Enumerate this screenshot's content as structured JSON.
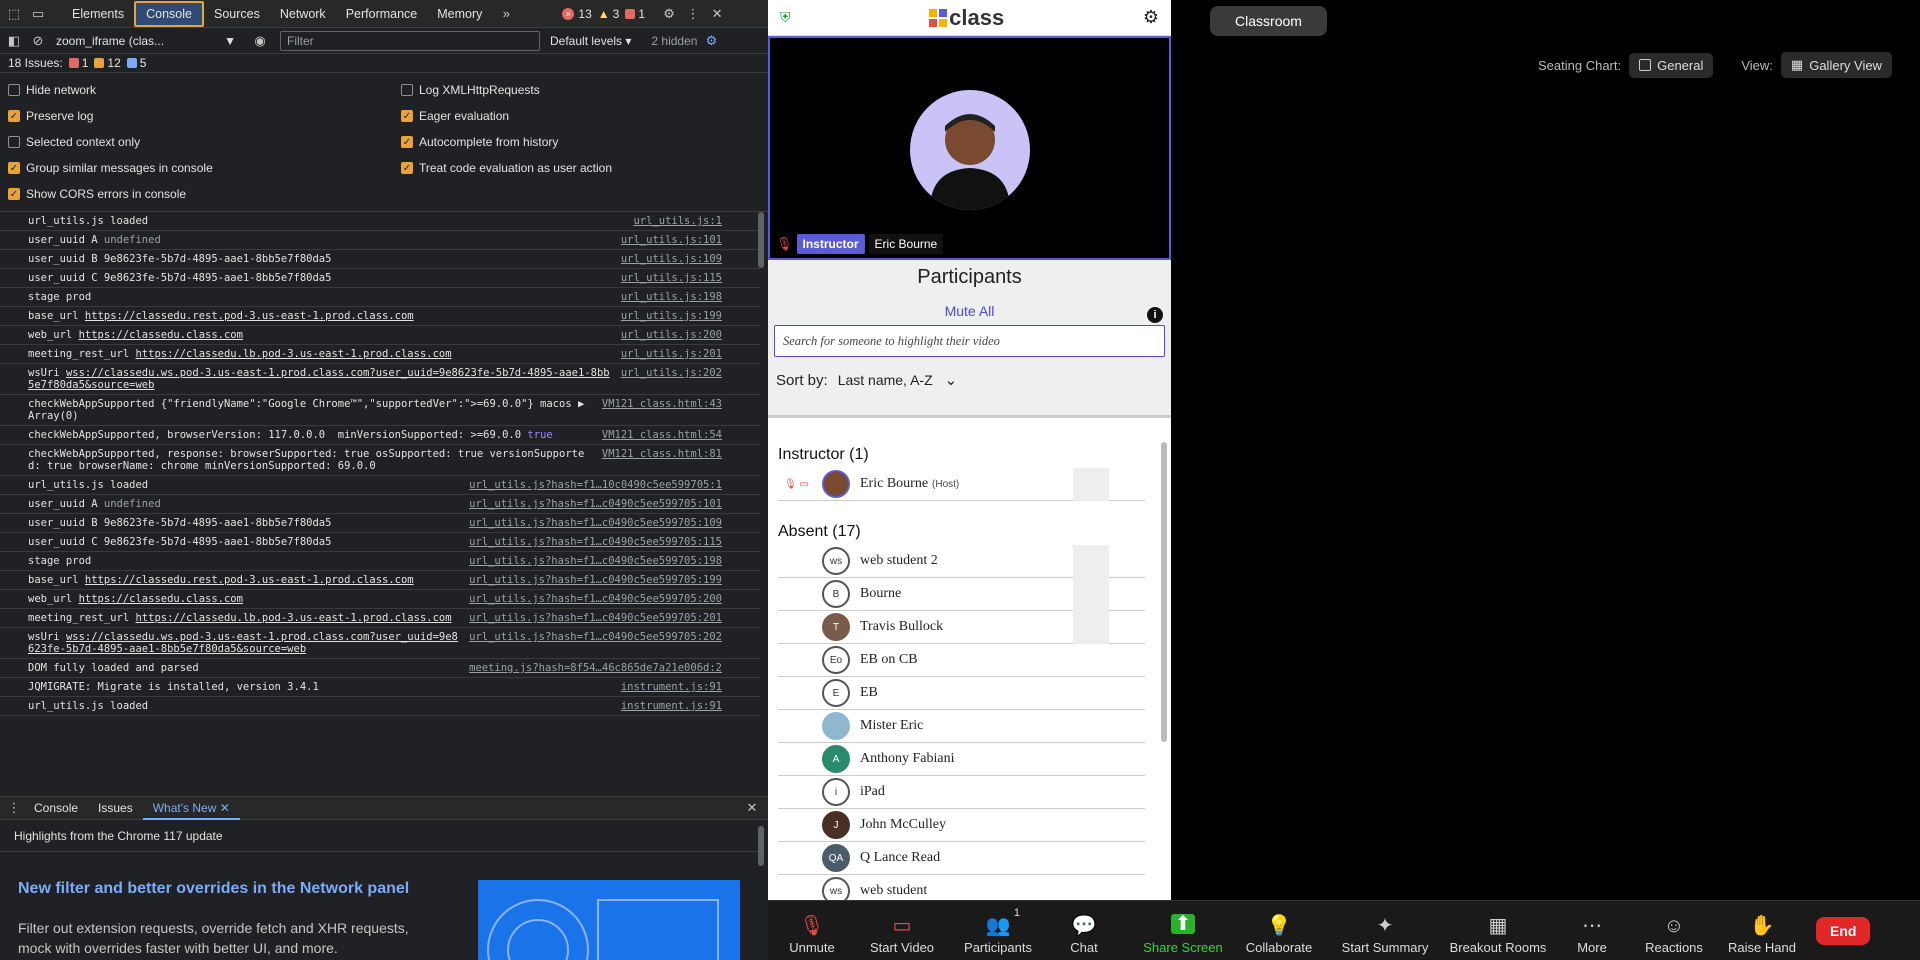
{
  "devtools": {
    "tabs": [
      "Elements",
      "Console",
      "Sources",
      "Network",
      "Performance",
      "Memory"
    ],
    "errors": "13",
    "warnings": "3",
    "info": "1",
    "context": "zoom_iframe (clas...",
    "filter_placeholder": "Filter",
    "levels": "Default levels",
    "hidden": "2 hidden",
    "issues_label": "18 Issues:",
    "issues_err": "1",
    "issues_warn": "12",
    "issues_info": "5",
    "settings_left": [
      {
        "label": "Hide network",
        "checked": false
      },
      {
        "label": "Preserve log",
        "checked": true
      },
      {
        "label": "Selected context only",
        "checked": false
      },
      {
        "label": "Group similar messages in console",
        "checked": true
      },
      {
        "label": "Show CORS errors in console",
        "checked": true
      }
    ],
    "settings_right": [
      {
        "label": "Log XMLHttpRequests",
        "checked": false
      },
      {
        "label": "Eager evaluation",
        "checked": true
      },
      {
        "label": "Autocomplete from history",
        "checked": true
      },
      {
        "label": "Treat code evaluation as user action",
        "checked": true
      }
    ],
    "messages": [
      {
        "text": "url_utils.js loaded",
        "src": "url_utils.js:1"
      },
      {
        "text": "user_uuid A",
        "undef": "undefined",
        "src": "url_utils.js:101"
      },
      {
        "text": "user_uuid B 9e8623fe-5b7d-4895-aae1-8bb5e7f80da5",
        "src": "url_utils.js:109"
      },
      {
        "text": "user_uuid C 9e8623fe-5b7d-4895-aae1-8bb5e7f80da5",
        "src": "url_utils.js:115"
      },
      {
        "text": "stage prod",
        "src": "url_utils.js:198"
      },
      {
        "text": "base_url",
        "link": "https://classedu.rest.pod-3.us-east-1.prod.class.com",
        "src": "url_utils.js:199"
      },
      {
        "text": "web_url",
        "link": "https://classedu.class.com",
        "src": "url_utils.js:200"
      },
      {
        "text": "meeting_rest_url",
        "link": "https://classedu.lb.pod-3.us-east-1.prod.class.com",
        "src": "url_utils.js:201"
      },
      {
        "text": "wsUri",
        "link": "wss://classedu.ws.pod-3.us-east-1.prod.class.com?user_uuid=9e8623fe-5b7d-4895-aae1-8bb5e7f80da5&source=web",
        "src": "url_utils.js:202"
      },
      {
        "text": "checkWebAppSupported {\"friendlyName\":\"Google Chrome™\",\"supportedVer\":\">=69.0.0\"} macos ▶ Array(0)",
        "src": "VM121 class.html:43"
      },
      {
        "text": "checkWebAppSupported, browserVersion: 117.0.0.0  minVersionSupported: >=69.0.0",
        "kw": "true",
        "src": "VM121 class.html:54"
      },
      {
        "text": "checkWebAppSupported, response: browserSupported: true osSupported: true versionSupported: true browserName: chrome minVersionSupported: 69.0.0",
        "src": "VM121 class.html:81"
      },
      {
        "text": "url_utils.js loaded",
        "src": "url_utils.js?hash=f1…10c0490c5ee599705:1"
      },
      {
        "text": "user_uuid A",
        "undef": "undefined",
        "src": "url_utils.js?hash=f1…c0490c5ee599705:101"
      },
      {
        "text": "user_uuid B 9e8623fe-5b7d-4895-aae1-8bb5e7f80da5",
        "src": "url_utils.js?hash=f1…c0490c5ee599705:109"
      },
      {
        "text": "user_uuid C 9e8623fe-5b7d-4895-aae1-8bb5e7f80da5",
        "src": "url_utils.js?hash=f1…c0490c5ee599705:115"
      },
      {
        "text": "stage prod",
        "src": "url_utils.js?hash=f1…c0490c5ee599705:198"
      },
      {
        "text": "base_url",
        "link": "https://classedu.rest.pod-3.us-east-1.prod.class.com",
        "src": "url_utils.js?hash=f1…c0490c5ee599705:199"
      },
      {
        "text": "web_url",
        "link": "https://classedu.class.com",
        "src": "url_utils.js?hash=f1…c0490c5ee599705:200"
      },
      {
        "text": "meeting_rest_url",
        "link": "https://classedu.lb.pod-3.us-east-1.prod.class.com",
        "src": "url_utils.js?hash=f1…c0490c5ee599705:201"
      },
      {
        "text": "wsUri",
        "link": "wss://classedu.ws.pod-3.us-east-1.prod.class.com?user_uuid=9e8623fe-5b7d-4895-aae1-8bb5e7f80da5&source=web",
        "src": "url_utils.js?hash=f1…c0490c5ee599705:202"
      },
      {
        "text": "DOM fully loaded and parsed",
        "src": "meeting.js?hash=8f54…46c865de7a21e006d:2"
      },
      {
        "text": "JQMIGRATE: Migrate is installed, version 3.4.1",
        "src": "instrument.js:91"
      },
      {
        "text": "url_utils.js loaded",
        "src": "instrument.js:91"
      }
    ],
    "drawer_tabs": [
      "Console",
      "Issues",
      "What's New"
    ],
    "whatsnew_header": "Highlights from the Chrome 117 update",
    "whatsnew_title": "New filter and better overrides in the Network panel",
    "whatsnew_text": "Filter out extension requests, override fetch and XHR requests, mock with overrides faster with better UI, and more."
  },
  "classapp": {
    "logo": "class",
    "instructor_badge": "Instructor",
    "instructor_name": "Eric Bourne",
    "participants_title": "Participants",
    "mute_all": "Mute All",
    "search_placeholder": "Search for someone to highlight their video",
    "sort_label": "Sort by:",
    "sort_value": "Last name, A-Z",
    "instructor_section": "Instructor (1)",
    "host_tag": "(Host)",
    "absent_section": "Absent  (17)",
    "absent": [
      {
        "initials": "ws",
        "name": "web student 2"
      },
      {
        "initials": "B",
        "name": "Bourne"
      },
      {
        "initials": "T",
        "name": "Travis Bullock",
        "color": "#7a5a48"
      },
      {
        "initials": "Eo",
        "name": "EB on CB"
      },
      {
        "initials": "E",
        "name": "EB"
      },
      {
        "initials": "",
        "name": "Mister Eric",
        "color": "#8fb8d0"
      },
      {
        "initials": "A",
        "name": "Anthony Fabiani",
        "color": "#2b8a6e"
      },
      {
        "initials": "i",
        "name": "iPad"
      },
      {
        "initials": "J",
        "name": "John McCulley",
        "color": "#4a2f24"
      },
      {
        "initials": "QA",
        "name": "Q Lance Read",
        "color": "#4b5c6b"
      },
      {
        "initials": "ws",
        "name": "web student"
      }
    ],
    "classroom_tab": "Classroom",
    "seating_label": "Seating Chart:",
    "seating_value": "General",
    "view_label": "View:",
    "view_value": "Gallery View",
    "participant_count": "1",
    "toolbar": [
      "Unmute",
      "Start Video",
      "Participants",
      "Chat",
      "Share Screen",
      "Collaborate",
      "Start Summary",
      "Breakout Rooms",
      "More",
      "Reactions",
      "Raise Hand"
    ],
    "end": "End"
  }
}
